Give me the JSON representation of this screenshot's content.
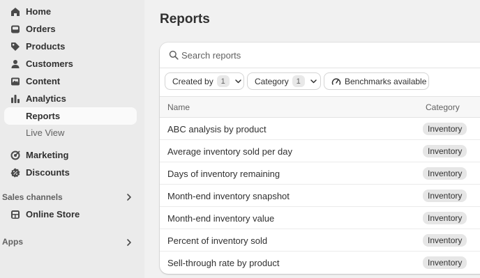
{
  "sidebar": {
    "items": [
      {
        "label": "Home",
        "icon": "home-icon"
      },
      {
        "label": "Orders",
        "icon": "inbox-icon"
      },
      {
        "label": "Products",
        "icon": "tag-icon"
      },
      {
        "label": "Customers",
        "icon": "person-icon"
      },
      {
        "label": "Content",
        "icon": "image-icon"
      },
      {
        "label": "Analytics",
        "icon": "bar-chart-icon"
      },
      {
        "label": "Reports"
      },
      {
        "label": "Live View"
      },
      {
        "label": "Marketing",
        "icon": "target-icon"
      },
      {
        "label": "Discounts",
        "icon": "discount-icon"
      }
    ],
    "sales_channels_label": "Sales channels",
    "online_store_label": "Online Store",
    "apps_label": "Apps"
  },
  "main": {
    "title": "Reports",
    "search_placeholder": "Search reports",
    "filters": {
      "created_by": {
        "label": "Created by",
        "count": "1"
      },
      "category": {
        "label": "Category",
        "count": "1"
      },
      "benchmarks": {
        "label": "Benchmarks available"
      }
    },
    "table": {
      "columns": [
        "Name",
        "Category"
      ],
      "rows": [
        {
          "name": "ABC analysis by product",
          "category": "Inventory"
        },
        {
          "name": "Average inventory sold per day",
          "category": "Inventory"
        },
        {
          "name": "Days of inventory remaining",
          "category": "Inventory"
        },
        {
          "name": "Month-end inventory snapshot",
          "category": "Inventory"
        },
        {
          "name": "Month-end inventory value",
          "category": "Inventory"
        },
        {
          "name": "Percent of inventory sold",
          "category": "Inventory"
        },
        {
          "name": "Sell-through rate by product",
          "category": "Inventory"
        }
      ]
    }
  }
}
